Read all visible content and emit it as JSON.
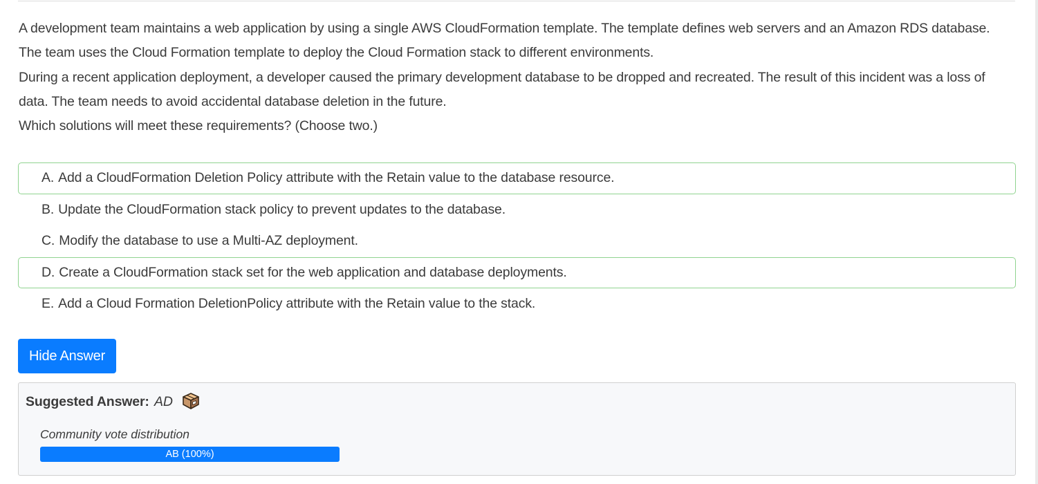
{
  "question": {
    "paragraphs": [
      "A development team maintains a web application by using a single AWS CloudFormation template. The template defines web servers and an Amazon RDS database. The team uses the Cloud Formation template to deploy the Cloud Formation stack to different environments.",
      "During a recent application deployment, a developer caused the primary development database to be dropped and recreated. The result of this incident was a loss of data. The team needs to avoid accidental database deletion in the future.",
      "Which solutions will meet these requirements? (Choose two.)"
    ]
  },
  "choices": [
    {
      "letter": "A.",
      "text": "Add a CloudFormation Deletion Policy attribute with the Retain value to the database resource.",
      "highlighted": true
    },
    {
      "letter": "B.",
      "text": "Update the CloudFormation stack policy to prevent updates to the database.",
      "highlighted": false
    },
    {
      "letter": "C.",
      "text": "Modify the database to use a Multi-AZ deployment.",
      "highlighted": false
    },
    {
      "letter": "D.",
      "text": "Create a CloudFormation stack set for the web application and database deployments.",
      "highlighted": true
    },
    {
      "letter": "E.",
      "text": "Add a Cloud Formation DeletionPolicy attribute with the Retain value to the stack.",
      "highlighted": false
    }
  ],
  "reveal_button_label": "Hide Answer",
  "answer": {
    "label": "Suggested Answer:",
    "value": "AD",
    "icon": "discussion-cube-icon"
  },
  "votes": {
    "label": "Community vote distribution",
    "distribution": [
      {
        "option": "AB",
        "percent": 100,
        "text": "AB (100%)"
      }
    ]
  },
  "colors": {
    "accent": "#0a7cff",
    "correct_border": "#8fd38f",
    "answer_background": "#f7f8fa"
  }
}
